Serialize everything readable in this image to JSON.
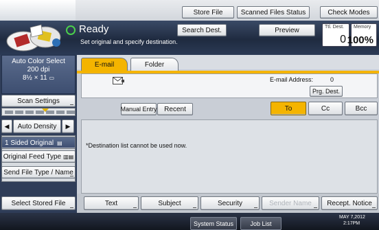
{
  "top_buttons": {
    "store_file": "Store File",
    "scanned_files_status": "Scanned Files Status",
    "check_modes": "Check Modes"
  },
  "status": {
    "ready": "Ready",
    "instruction": "Set original and specify destination.",
    "search_dest": "Search Dest.",
    "preview": "Preview",
    "ttl_dest_label": "Ttl. Dest.",
    "ttl_dest_value": "0",
    "memory_label": "Memory",
    "memory_value": "100%"
  },
  "left": {
    "mode_line1": "Auto Color Select",
    "mode_line2": "200 dpi",
    "mode_line3": "8½ × 11",
    "scan_settings": "Scan Settings",
    "auto_density": "Auto Density",
    "one_sided": "1 Sided Original",
    "orig_feed": "Original Feed Type",
    "send_file_type": "Send File Type / Name",
    "select_stored": "Select Stored File"
  },
  "tabs": {
    "email": "E-mail",
    "folder": "Folder"
  },
  "address": {
    "label": "E-mail Address:",
    "count": "0",
    "prg_dest": "Prg. Dest."
  },
  "entry_buttons": {
    "manual_entry": "Manual Entry",
    "recent": "Recent",
    "to": "To",
    "cc": "Cc",
    "bcc": "Bcc"
  },
  "message": "*Destination list cannot be used now.",
  "bottom": {
    "text": "Text",
    "subject": "Subject",
    "security": "Security",
    "sender_name": "Sender Name",
    "recept_notice": "Recept. Notice"
  },
  "footer": {
    "system_status": "System Status",
    "job_list": "Job List",
    "date_line": "MAY  7,2012",
    "time_line": "2:17PM"
  },
  "colors": {
    "accent": "#f4b400",
    "ready_green": "#4bd14b",
    "status_band": "#1f2b40"
  }
}
